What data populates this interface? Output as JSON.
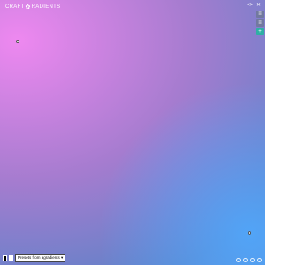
{
  "app": {
    "logo_left": "CRAFT",
    "logo_mark": "✿",
    "logo_right": "RADIENTS"
  },
  "toolbar": {
    "icons": [
      "share-icon",
      "close-icon"
    ],
    "share_glyph": "<>",
    "close_glyph": "✕"
  },
  "side_panel": {
    "buttons": [
      {
        "name": "color-mode-button",
        "glyph": "≡"
      },
      {
        "name": "layers-button",
        "glyph": "≡"
      },
      {
        "name": "add-button",
        "glyph": "+"
      }
    ]
  },
  "bottom": {
    "swatches": [
      "#000000",
      "#ffffff"
    ],
    "preset_label": "Presets from agradients ▾"
  },
  "colors": {
    "pink": "#ee88f0",
    "purple": "#a57ccf",
    "blue": "#4f99ea",
    "accent": "#2fb0a4"
  }
}
